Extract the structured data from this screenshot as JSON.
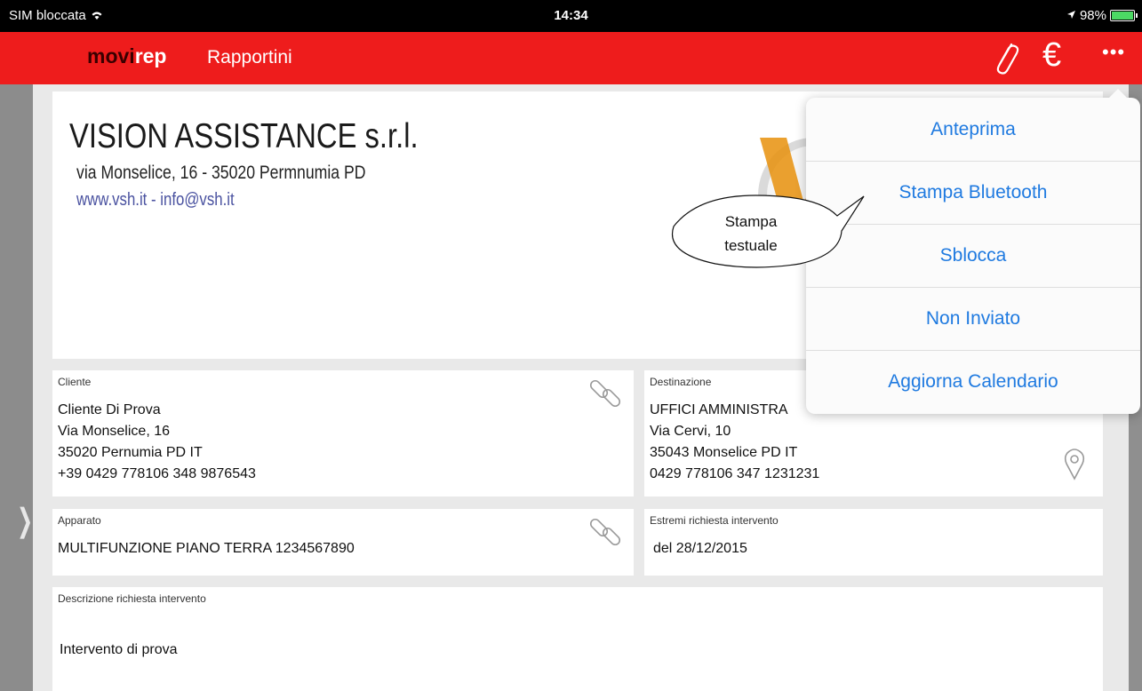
{
  "status_bar": {
    "carrier": "SIM bloccata",
    "time": "14:34",
    "battery": "98%",
    "battery_level": 0.98
  },
  "navbar": {
    "brand_prefix": "movi",
    "brand_suffix": "rep",
    "title": "Rapportini",
    "icons": [
      "paperclip-icon",
      "euro-icon",
      "more-icon"
    ],
    "euro_symbol": "€",
    "more_symbol": "•••"
  },
  "header": {
    "company": "VISION ASSISTANCE s.r.l.",
    "address": "via Monselice, 16 - 35020 Permnumia PD",
    "web": "www.vsh.it - info@vsh.it"
  },
  "cliente": {
    "label": "Cliente",
    "lines": [
      "Cliente Di Prova",
      "Via Monselice, 16",
      "35020  Pernumia  PD  IT",
      "+39 0429 778106  348 9876543"
    ]
  },
  "destinazione": {
    "label": "Destinazione",
    "lines": [
      "UFFICI AMMINISTRA",
      "Via Cervi, 10",
      "35043  Monselice  PD  IT",
      "0429 778106  347 1231231"
    ]
  },
  "apparato": {
    "label": "Apparato",
    "value": "MULTIFUNZIONE PIANO TERRA  1234567890"
  },
  "estremi": {
    "label": "Estremi richiesta intervento",
    "value": "del 28/12/2015"
  },
  "descrizione": {
    "label": "Descrizione richiesta intervento",
    "value": "Intervento di prova"
  },
  "popover_menu": {
    "items": [
      "Anteprima",
      "Stampa Bluetooth",
      "Sblocca",
      "Non Inviato",
      "Aggiorna Calendario"
    ]
  },
  "callout": {
    "line1": "Stampa",
    "line2": "testuale"
  },
  "colors": {
    "brand_red": "#ee1c1c",
    "menu_blue": "#1f7ae0"
  }
}
